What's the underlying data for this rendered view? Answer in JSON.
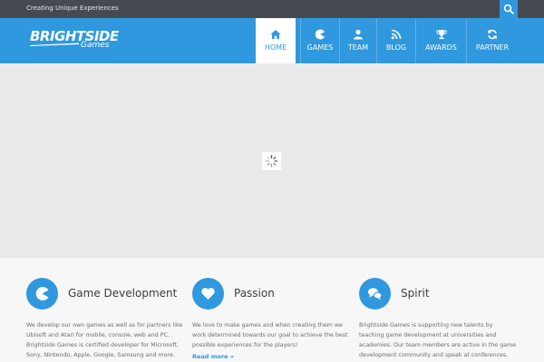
{
  "topbar": {
    "tagline": "Creating Unique Experiences",
    "search_icon": "search-icon"
  },
  "brand": {
    "name": "BRIGHTSIDE",
    "sub": "Games"
  },
  "nav": {
    "items": [
      {
        "label": "HOME",
        "icon": "home-icon",
        "active": true
      },
      {
        "label": "GAMES",
        "icon": "pacman-icon",
        "active": false
      },
      {
        "label": "TEAM",
        "icon": "user-icon",
        "active": false
      },
      {
        "label": "BLOG",
        "icon": "rss-icon",
        "active": false
      },
      {
        "label": "AWARDS",
        "icon": "trophy-icon",
        "active": false
      },
      {
        "label": "PARTNER",
        "icon": "refresh-icon",
        "active": false
      }
    ]
  },
  "slider": {
    "loader_icon": "spinner-icon"
  },
  "features": [
    {
      "title": "Game Development",
      "icon": "pacman-icon",
      "text": "We develop our own games as well as for partners like Ubisoft and Atari for mobile, console, web and PC. Brightside Games is certified developer for Microsoft, Sony, Nintendo, Apple, Google, Samsung and more."
    },
    {
      "title": "Passion",
      "icon": "heart-icon",
      "text": "We love to make games and when creating them we work determined towards our goal to achieve the best possible experiences for the players!",
      "readmore": "Read more"
    },
    {
      "title": "Spirit",
      "icon": "chat-icon",
      "text": "Brightside Games is supporting new talents by teaching game development at universities and academies. Our team members are active in the game development community and speak at conferences."
    }
  ],
  "colors": {
    "accent": "#2f98de",
    "topbar": "#454a50",
    "slider_bg": "#eaeaea",
    "features_bg": "#f7f7f7"
  }
}
